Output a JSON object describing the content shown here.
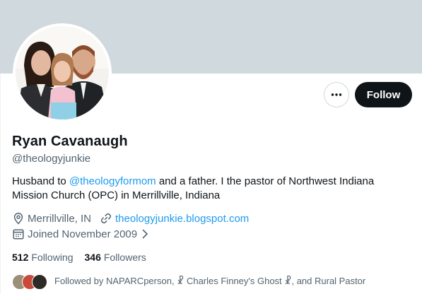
{
  "profile": {
    "name": "Ryan Cavanaugh",
    "handle": "@theologyjunkie",
    "bio_before": "Husband to ",
    "bio_mention": "@theologyformom",
    "bio_after": " and a father. I the pastor of Northwest Indiana Mission Church (OPC) in Merrillville, Indiana",
    "location": "Merrillville, IN",
    "website": "theologyjunkie.blogspot.com",
    "joined": "Joined November 2009"
  },
  "actions": {
    "follow_label": "Follow"
  },
  "stats": {
    "following_count": "512",
    "following_label": "Following",
    "followers_count": "346",
    "followers_label": "Followers"
  },
  "followed_by": {
    "text": "Followed by NAPARCperson, ☧ Charles Finney's Ghost ☧, and Rural Pastor"
  },
  "colors": {
    "banner": "#cfd9de",
    "accent": "#1d9bf0",
    "follow_button": "#0f1419",
    "secondary_text": "#536471"
  },
  "icons": [
    "more-icon",
    "location-icon",
    "link-icon",
    "calendar-icon",
    "chevron-right-icon"
  ]
}
